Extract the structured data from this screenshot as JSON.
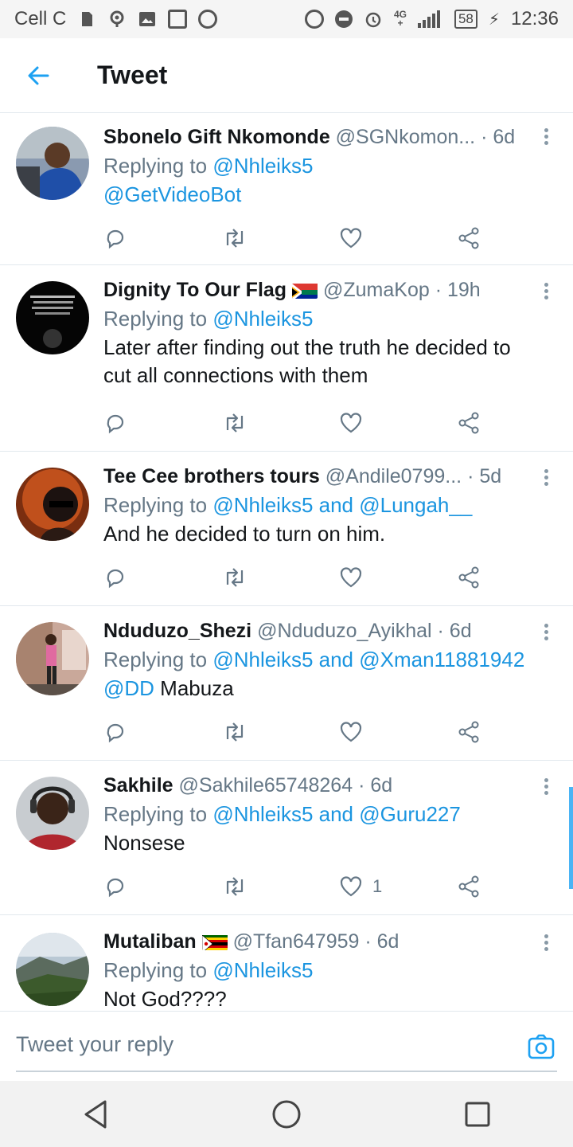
{
  "status_bar": {
    "carrier": "Cell C",
    "network_top": "4G",
    "network_bottom": "+",
    "battery": "58",
    "time": "12:36"
  },
  "header": {
    "back_icon": "arrow-left-icon",
    "title": "Tweet"
  },
  "colors": {
    "accent": "#1da1f2",
    "link": "#1b95e0",
    "muted": "#657786",
    "text": "#14171a",
    "divider": "#e1e8ed"
  },
  "tweets": [
    {
      "name": "Sbonelo Gift Nkomonde",
      "handle": "@SGNkomon...",
      "time": "· 6d",
      "reply_prefix": "Replying to",
      "reply_mentions": "@Nhleiks5",
      "text_link": "@GetVideoBot",
      "text": "",
      "likes": ""
    },
    {
      "name": "Dignity To Our Flag",
      "flag": "South Africa flag",
      "handle": "@ZumaKop",
      "time": "· 19h",
      "reply_prefix": "Replying to",
      "reply_mentions": "@Nhleiks5",
      "text_link": "",
      "text": "Later after finding out the truth he decided to cut all connections with them",
      "likes": ""
    },
    {
      "name": "Tee Cee brothers tours",
      "handle": "@Andile0799...",
      "time": "· 5d",
      "reply_prefix": "Replying to",
      "reply_mentions": "@Nhleiks5 and @Lungah__",
      "text_link": "",
      "text": "And he decided to turn on him.",
      "likes": ""
    },
    {
      "name": "Nduduzo_Shezi",
      "handle": "@Nduduzo_Ayikhal",
      "time": "· 6d",
      "reply_prefix": "Replying to",
      "reply_mentions": "@Nhleiks5 and @Xman11881942",
      "text_link": "@DD",
      "text": " Mabuza",
      "likes": ""
    },
    {
      "name": "Sakhile",
      "handle": "@Sakhile65748264",
      "time": "· 6d",
      "reply_prefix": "Replying to",
      "reply_mentions": "@Nhleiks5 and @Guru227",
      "text_link": "",
      "text": "Nonsese",
      "likes": "1"
    },
    {
      "name": "Mutaliban",
      "flag": "Zimbabwe flag",
      "handle": "@Tfan647959",
      "time": "· 6d",
      "reply_prefix": "Replying to",
      "reply_mentions": "@Nhleiks5",
      "text_link": "",
      "text": "Not God????",
      "likes": ""
    }
  ],
  "composer": {
    "placeholder": "Tweet your reply",
    "camera_icon": "camera-icon"
  },
  "nav_bar": {
    "back": "back-triangle-icon",
    "home": "home-circle-icon",
    "recents": "recents-square-icon"
  }
}
